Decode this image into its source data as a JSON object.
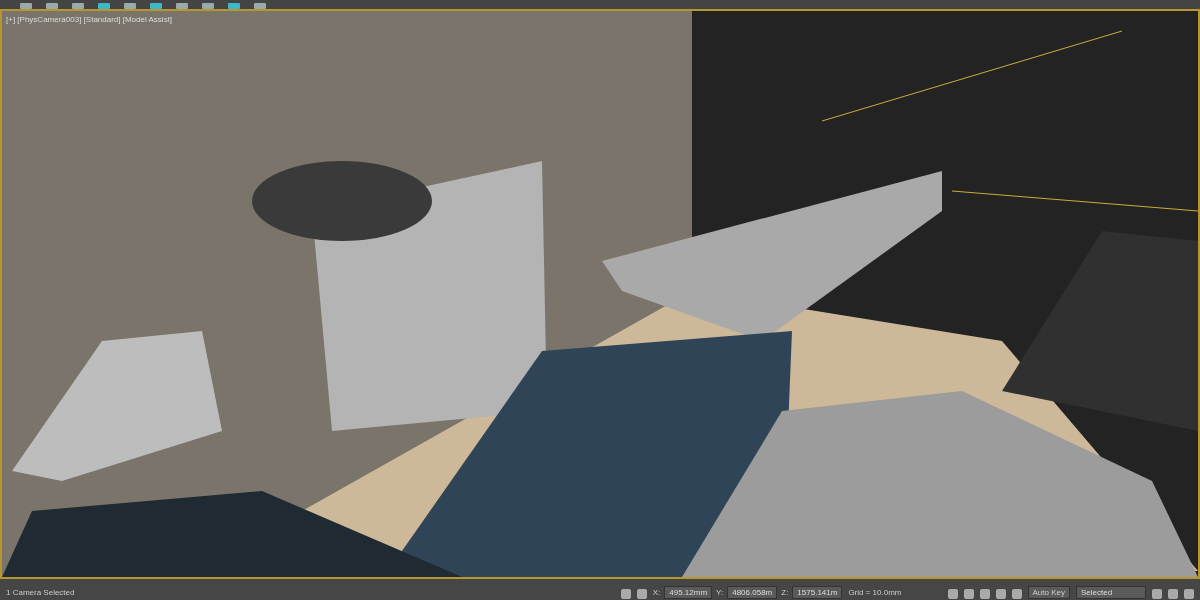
{
  "viewport": {
    "label": "[+] [PhysCamera003] [Standard] [Model Assist]"
  },
  "status_bar": {
    "message": "1 Camera Selected",
    "coords": [
      {
        "axis": "X:",
        "value": "495.12mm"
      },
      {
        "axis": "Y:",
        "value": "4806.058m"
      },
      {
        "axis": "Z:",
        "value": "1575.141m"
      }
    ],
    "grid": "Grid = 10.0mm",
    "auto_key": "Auto Key",
    "selection_set": "Selected"
  }
}
